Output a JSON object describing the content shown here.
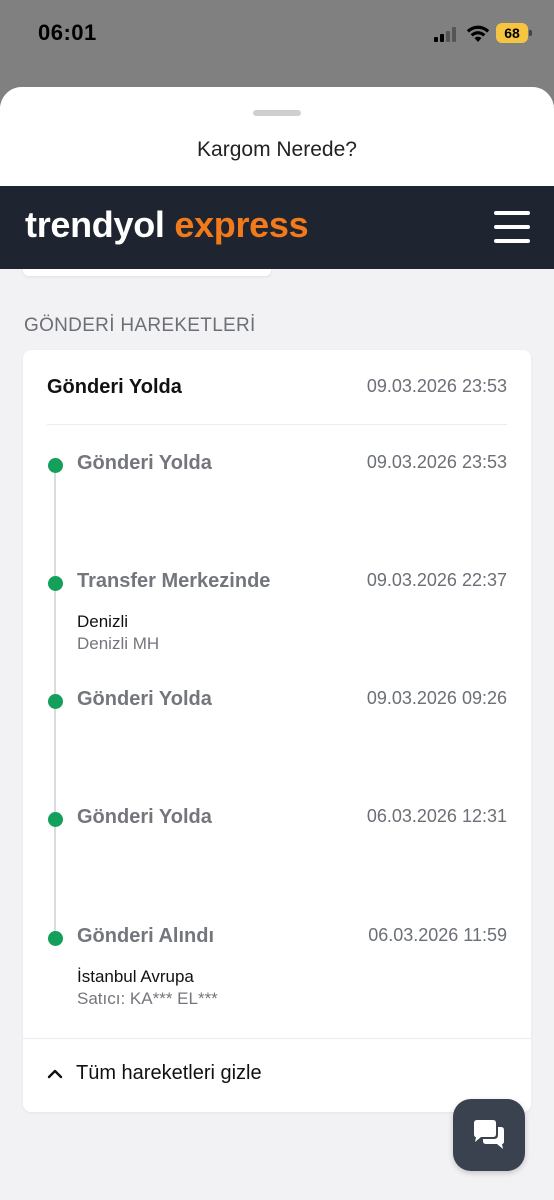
{
  "status_bar": {
    "time": "06:01",
    "battery": "68"
  },
  "sheet": {
    "title": "Kargom Nerede?"
  },
  "brand": {
    "part1": "trendyol",
    "part2": "express",
    "colors": {
      "dark": "#1f2530",
      "orange": "#f27a1a"
    }
  },
  "section": {
    "title": "GÖNDERİ HAREKETLERİ"
  },
  "card": {
    "status": "Gönderi Yolda",
    "date": "09.03.2026 23:53",
    "events": [
      {
        "title": "Gönderi Yolda",
        "date": "09.03.2026 23:53",
        "location": "",
        "sub": ""
      },
      {
        "title": "Transfer Merkezinde",
        "date": "09.03.2026 22:37",
        "location": "Denizli",
        "sub": "Denizli MH"
      },
      {
        "title": "Gönderi Yolda",
        "date": "09.03.2026 09:26",
        "location": "",
        "sub": ""
      },
      {
        "title": "Gönderi Yolda",
        "date": "06.03.2026 12:31",
        "location": "",
        "sub": ""
      },
      {
        "title": "Gönderi Alındı",
        "date": "06.03.2026 11:59",
        "location": "İstanbul Avrupa",
        "sub": "Satıcı: KA*** EL***"
      }
    ],
    "toggle_label": "Tüm hareketleri gizle"
  },
  "icons": {
    "signal": "cellular-signal-icon",
    "wifi": "wifi-icon",
    "menu": "hamburger-menu-icon",
    "toggle": "chevron-up-icon",
    "chat": "chat-bubbles-icon"
  },
  "colors": {
    "dot": "#14a05a",
    "battery": "#f5c542"
  }
}
